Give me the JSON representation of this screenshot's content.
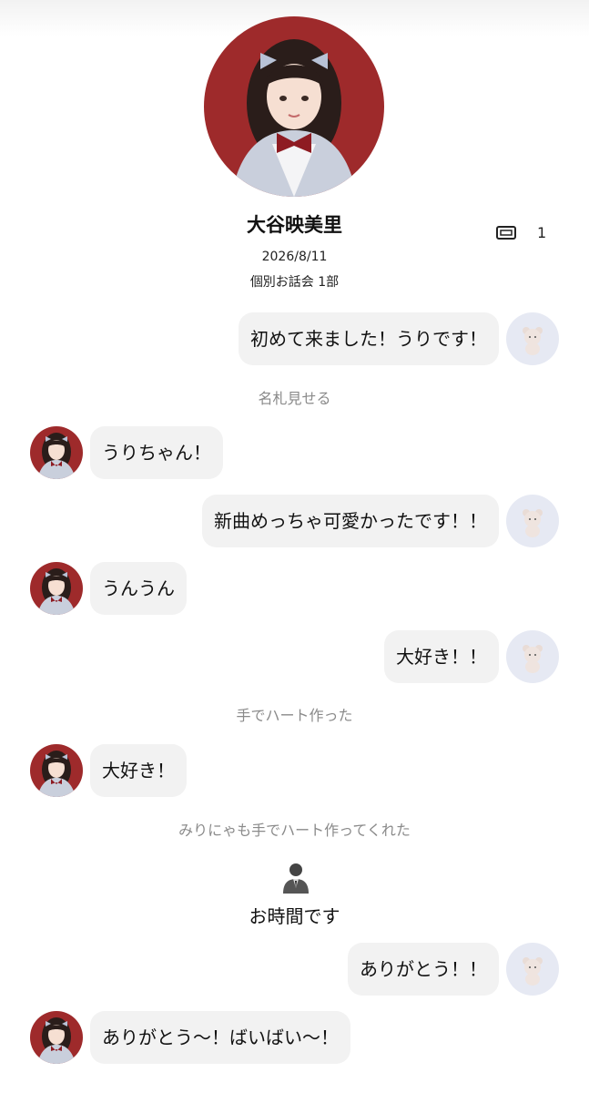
{
  "profile": {
    "name": "大谷映美里",
    "ticket_count": "1",
    "date": "2026/8/11",
    "event": "個別お話会 1部"
  },
  "chat": [
    {
      "side": "right",
      "text": "初めて来ました！うりです！"
    },
    {
      "note": "名札見せる"
    },
    {
      "side": "left",
      "text": "うりちゃん！"
    },
    {
      "side": "right",
      "text": "新曲めっちゃ可愛かったです！！"
    },
    {
      "side": "left",
      "text": "うんうん"
    },
    {
      "side": "right",
      "text": "大好き！！"
    },
    {
      "note": "手でハート作った"
    },
    {
      "side": "left",
      "text": "大好き！"
    },
    {
      "note": "みりにゃも手でハート作ってくれた"
    },
    {
      "staff": "お時間です"
    },
    {
      "side": "right",
      "text": "ありがとう！！"
    },
    {
      "side": "left",
      "text": "ありがとう〜！ばいばい〜！"
    }
  ],
  "icons": {
    "ticket": "ticket-icon",
    "staff": "staff-person-icon",
    "idol_avatar": "idol-avatar",
    "user_avatar": "bear-avatar"
  },
  "colors": {
    "bubble": "#f2f2f2",
    "note_text": "#8a8a8a",
    "avatar_bg": "#9e2a2b"
  }
}
